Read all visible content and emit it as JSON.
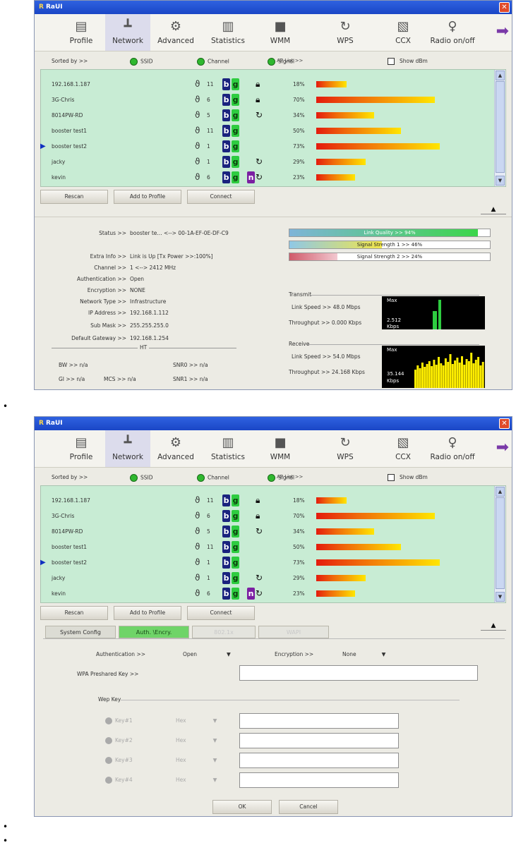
{
  "window_title": "RaUI",
  "toolbar": [
    "Profile",
    "Network",
    "Advanced",
    "Statistics",
    "WMM",
    "WPS",
    "CCX",
    "Radio on/off"
  ],
  "toolbar_icons": [
    "profile-icon",
    "network-icon",
    "advanced-icon",
    "statistics-icon",
    "wmm-icon",
    "wps-icon",
    "ccx-icon",
    "radio-icon"
  ],
  "sort": {
    "label": "Sorted by >>",
    "ssid": "SSID",
    "channel": "Channel",
    "signal": "Signal",
    "show_dbm": "Show dBm",
    "ap_list": "AP List >>"
  },
  "aps": [
    {
      "ssid": "192.168.1.187",
      "ch": "11",
      "n": false,
      "enc": "lock",
      "pct": "18%",
      "level": 18
    },
    {
      "ssid": "3G-Chris",
      "ch": "6",
      "n": false,
      "enc": "lock",
      "pct": "70%",
      "level": 70
    },
    {
      "ssid": "8014PW-RD",
      "ch": "5",
      "n": false,
      "enc": "wps",
      "pct": "34%",
      "level": 34
    },
    {
      "ssid": "booster test1",
      "ch": "11",
      "n": false,
      "enc": "",
      "pct": "50%",
      "level": 50
    },
    {
      "ssid": "booster test2",
      "ch": "1",
      "n": false,
      "enc": "",
      "pct": "73%",
      "level": 73
    },
    {
      "ssid": "jacky",
      "ch": "1",
      "n": false,
      "enc": "wps",
      "pct": "29%",
      "level": 29
    },
    {
      "ssid": "kevin",
      "ch": "6",
      "n": true,
      "enc": "wps",
      "pct": "23%",
      "level": 23
    }
  ],
  "ap_letters": {
    "b": "b",
    "g": "g",
    "n": "n"
  },
  "buttons": {
    "rescan": "Rescan",
    "add_profile": "Add to Profile",
    "connect": "Connect",
    "ok": "OK",
    "cancel": "Cancel"
  },
  "status": {
    "status_k": "Status >>",
    "status_v": "booster te... <--> 00-1A-EF-0E-DF-C9",
    "extra_k": "Extra Info >>",
    "extra_v": "Link is Up [Tx Power >>:100%]",
    "channel_k": "Channel >>",
    "channel_v": "1 <--> 2412 MHz",
    "auth_k": "Authentication >>",
    "auth_v": "Open",
    "enc_k": "Encryption >>",
    "enc_v": "NONE",
    "nettype_k": "Network Type >>",
    "nettype_v": "Infrastructure",
    "ip_k": "IP Address >>",
    "ip_v": "192.168.1.112",
    "mask_k": "Sub Mask >>",
    "mask_v": "255.255.255.0",
    "gw_k": "Default Gateway >>",
    "gw_v": "192.168.1.254",
    "ht": "HT",
    "bw": "BW >> n/a",
    "gi": "GI >> n/a",
    "mcs": "MCS >> n/a",
    "snr0": "SNR0 >> n/a",
    "snr1": "SNR1 >> n/a"
  },
  "quality": {
    "link": "Link Quality >> 94%",
    "link_level": 94,
    "s1": "Signal Strength 1 >> 46%",
    "s1_level": 46,
    "s2": "Signal Strength 2 >> 24%",
    "s2_level": 24
  },
  "transmit": {
    "title": "Transmit",
    "speed": "Link Speed >> 48.0 Mbps",
    "tput": "Throughput >> 0.000 Kbps",
    "max": "Max",
    "val": "2.512",
    "unit": "Kbps"
  },
  "receive": {
    "title": "Receive",
    "speed": "Link Speed >> 54.0 Mbps",
    "tput": "Throughput >> 24.168 Kbps",
    "max": "Max",
    "val": "35.144",
    "unit": "Kbps"
  },
  "tabs": [
    "System Config",
    "Auth. \\Encry.",
    "802.1x",
    "WAPI"
  ],
  "auth_form": {
    "auth_k": "Authentication >>",
    "auth_v": "Open",
    "enc_k": "Encryption >>",
    "enc_v": "None",
    "wpa_k": "WPA Preshared Key >>",
    "wep": "Wep Key",
    "keys": [
      "Key#1",
      "Key#2",
      "Key#3",
      "Key#4"
    ],
    "hex": "Hex"
  },
  "colors": {
    "list_bg": "#c8ecd4",
    "title": "#1a46c6",
    "tab_active": "#6fd468"
  }
}
